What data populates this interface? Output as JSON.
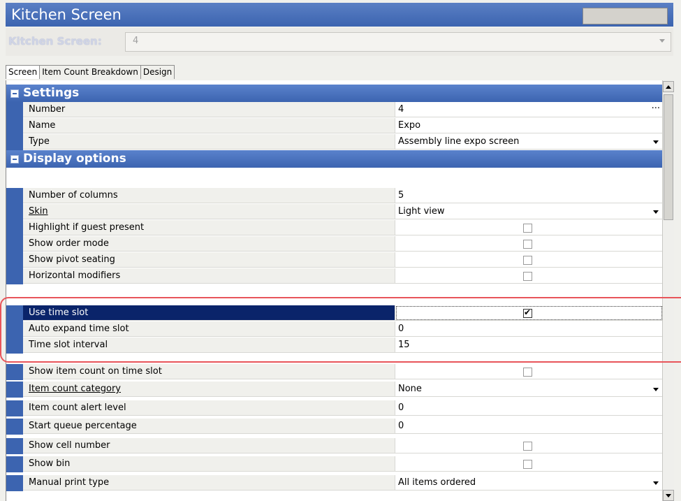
{
  "window": {
    "title": "Kitchen Screen"
  },
  "selector": {
    "label": "Kitchen Screen:",
    "value": "4"
  },
  "tabs": [
    {
      "label": "Screen",
      "active": true
    },
    {
      "label": "Item Count Breakdown",
      "active": false
    },
    {
      "label": "Design",
      "active": false
    }
  ],
  "categories": {
    "settings": "Settings",
    "display": "Display options"
  },
  "rows": {
    "number": {
      "name": "Number",
      "value": "4"
    },
    "name": {
      "name": "Name",
      "value": "Expo"
    },
    "type": {
      "name": "Type",
      "value": "Assembly line expo screen"
    },
    "columns": {
      "name": "Number of columns",
      "value": "5"
    },
    "skin": {
      "name": "Skin",
      "value": "Light view"
    },
    "highlight_guest": {
      "name": "Highlight if guest present",
      "checked": false
    },
    "order_mode": {
      "name": "Show order mode",
      "checked": false
    },
    "pivot_seating": {
      "name": "Show pivot seating",
      "checked": false
    },
    "horizontal_mod": {
      "name": "Horizontal modifiers",
      "checked": false
    },
    "use_time_slot": {
      "name": "Use time slot",
      "checked": true
    },
    "auto_expand": {
      "name": "Auto expand time slot",
      "value": "0"
    },
    "slot_interval": {
      "name": "Time slot interval",
      "value": "15"
    },
    "item_count_slot": {
      "name": "Show item count on time slot",
      "checked": false
    },
    "item_count_cat": {
      "name": "Item count category",
      "value": "None"
    },
    "alert_level": {
      "name": "Item count alert level",
      "value": "0"
    },
    "queue_pct": {
      "name": "Start queue percentage",
      "value": "0"
    },
    "cell_number": {
      "name": "Show cell number",
      "checked": false
    },
    "show_bin": {
      "name": "Show bin",
      "checked": false
    },
    "manual_print": {
      "name": "Manual print type",
      "value": "All items ordered"
    }
  },
  "icons": {
    "ellipsis": "ellipsis-icon",
    "dropdown": "chevron-down-icon",
    "collapse": "collapse-icon",
    "check": "✔"
  },
  "colors": {
    "header_blue": "#3c64b0",
    "selected_row": "#0a246a",
    "annotation_red": "#e8555a"
  }
}
